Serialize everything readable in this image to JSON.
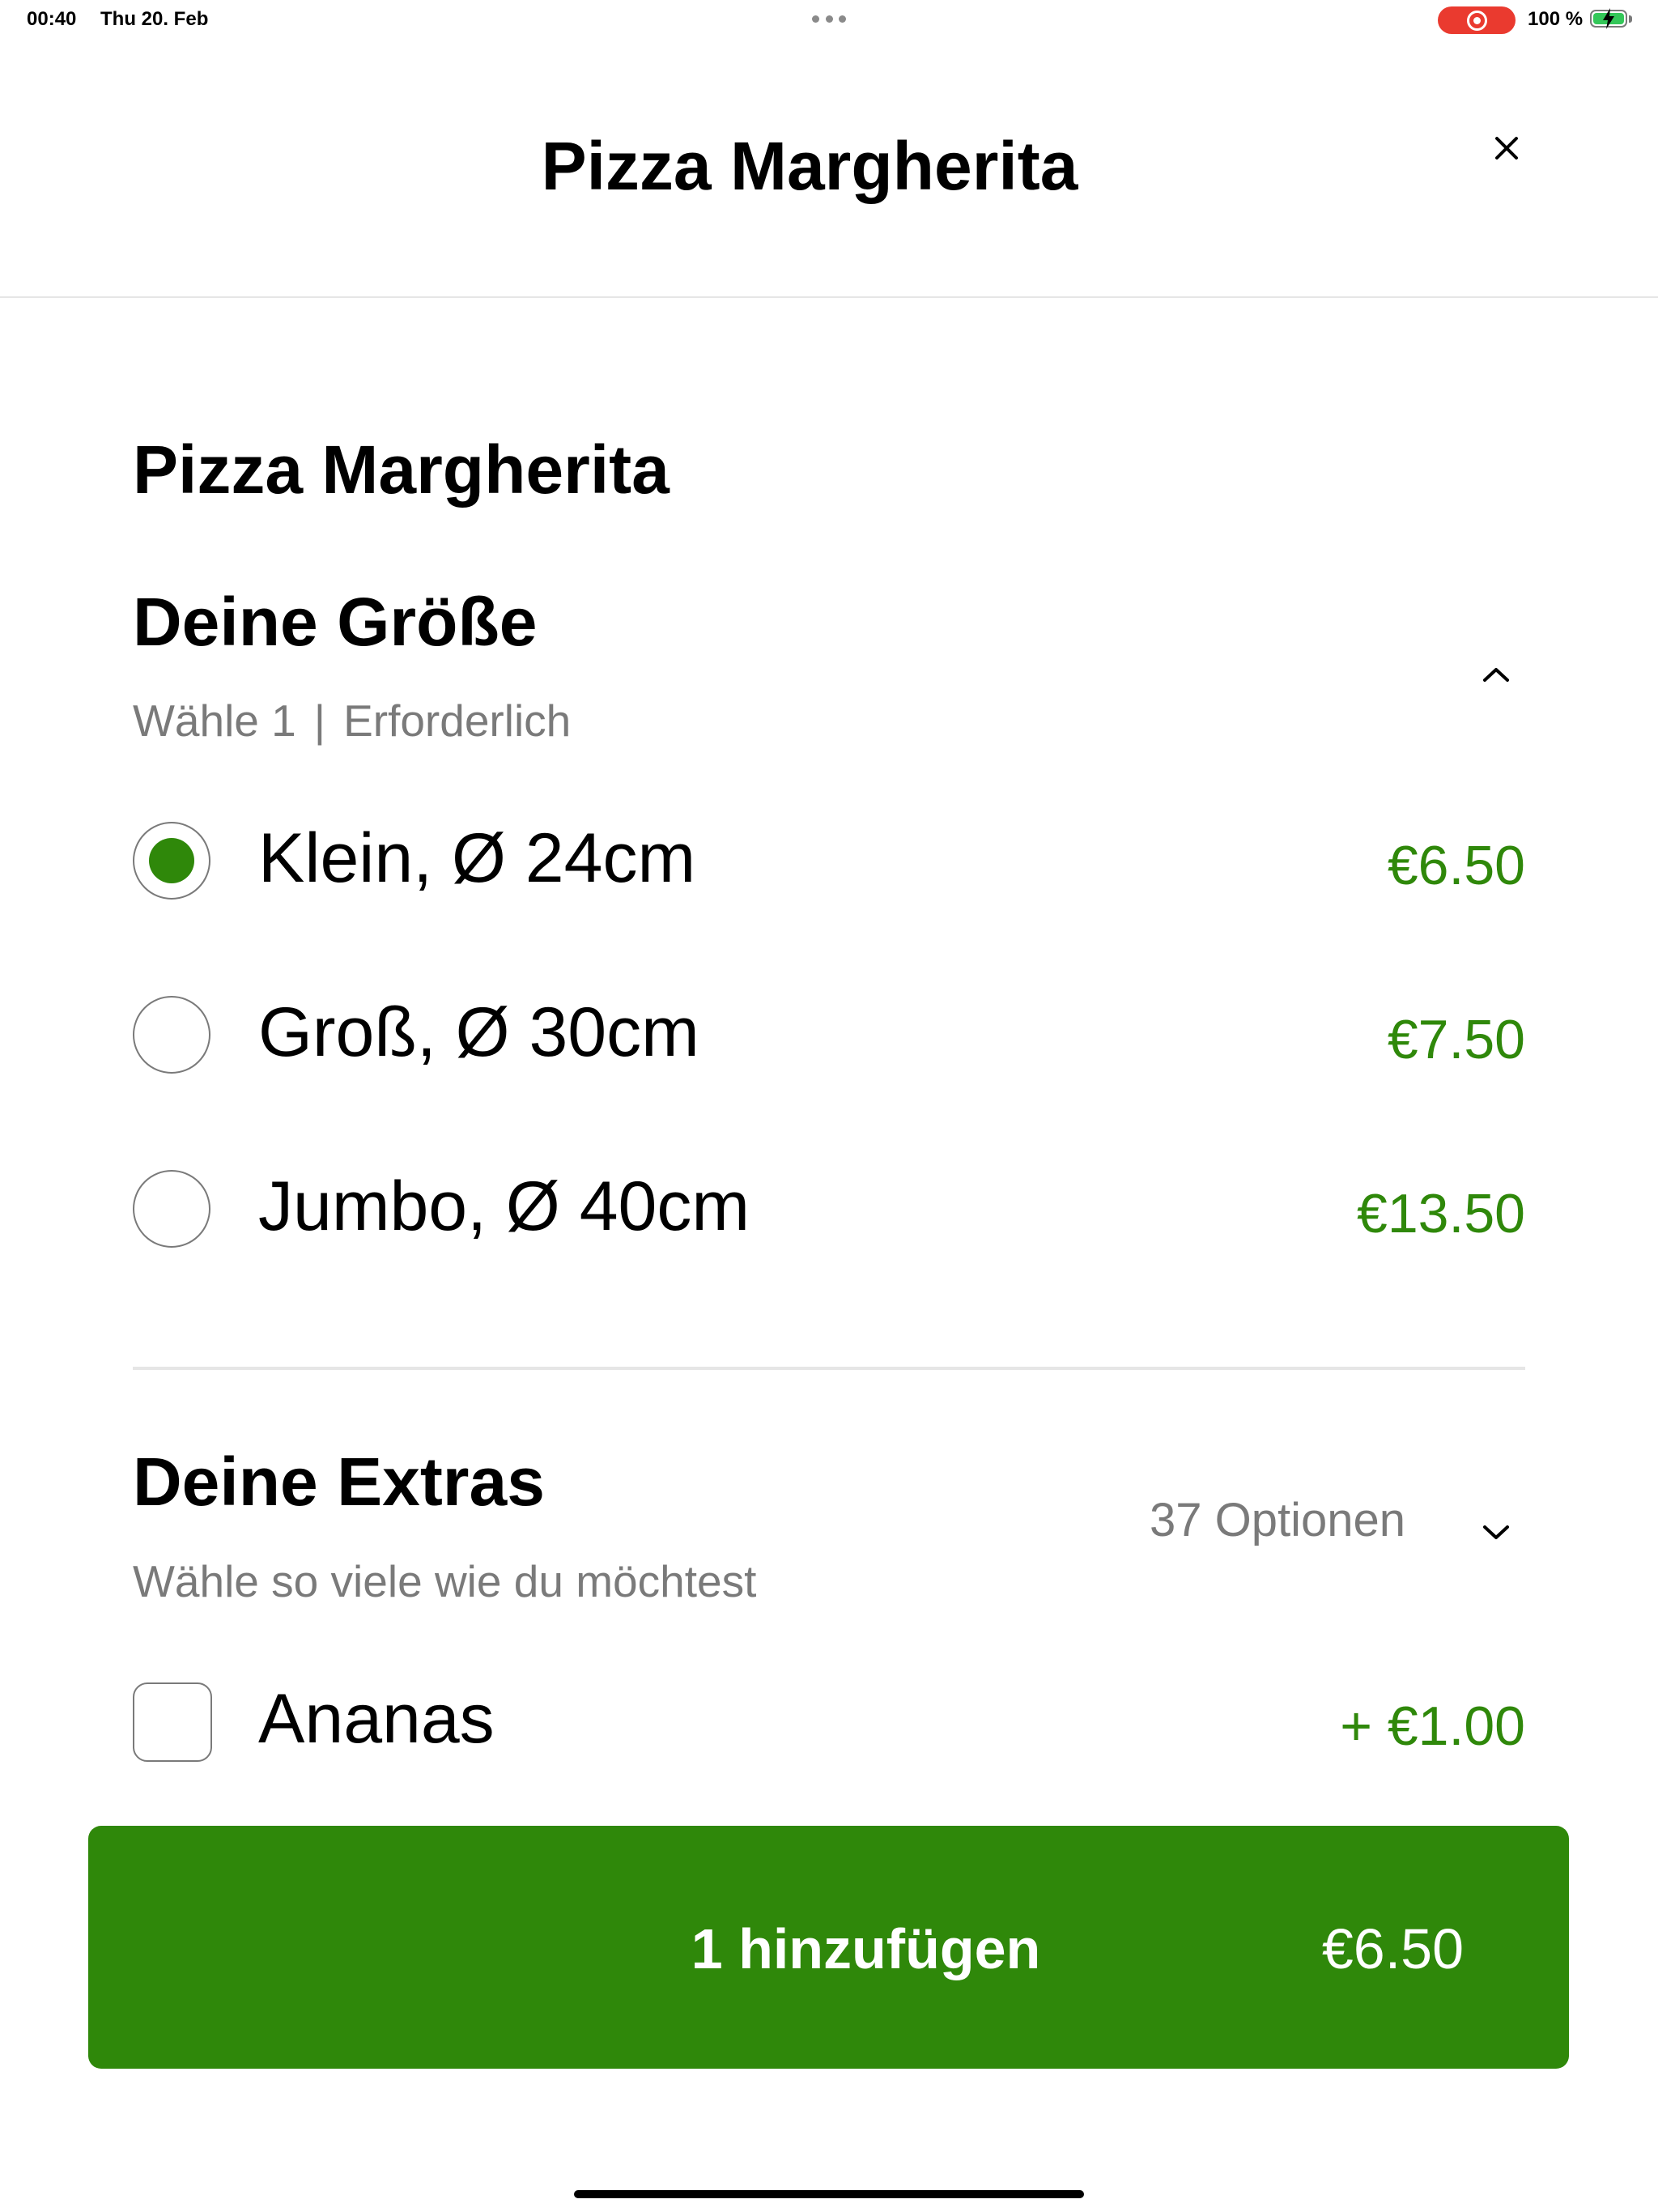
{
  "status_bar": {
    "time": "00:40",
    "date": "Thu 20. Feb",
    "battery_text": "100 %",
    "record_color": "#ea3a2f",
    "battery_color": "#34c759"
  },
  "header": {
    "title": "Pizza Margherita",
    "close_icon": "close-icon"
  },
  "product": {
    "title": "Pizza Margherita"
  },
  "size_section": {
    "title": "Deine Größe",
    "choose": "Wähle 1",
    "separator": "|",
    "required": "Erforderlich",
    "chevron_icon": "chevron-up-icon",
    "options": [
      {
        "label": "Klein, Ø 24cm",
        "price": "€6.50",
        "selected": true
      },
      {
        "label": "Groß, Ø 30cm",
        "price": "€7.50",
        "selected": false
      },
      {
        "label": "Jumbo, Ø 40cm",
        "price": "€13.50",
        "selected": false
      }
    ]
  },
  "extras_section": {
    "title": "Deine Extras",
    "subtitle": "Wähle so viele wie du möchtest",
    "count": "37 Optionen",
    "chevron_icon": "chevron-down-icon",
    "options": [
      {
        "label": "Ananas",
        "price": "+ €1.00",
        "checked": false
      }
    ]
  },
  "add_button": {
    "label": "1 hinzufügen",
    "price": "€6.50"
  },
  "colors": {
    "accent": "#2f880a",
    "secondary_text": "#7a7a7a",
    "divider": "#e6e6e6"
  }
}
